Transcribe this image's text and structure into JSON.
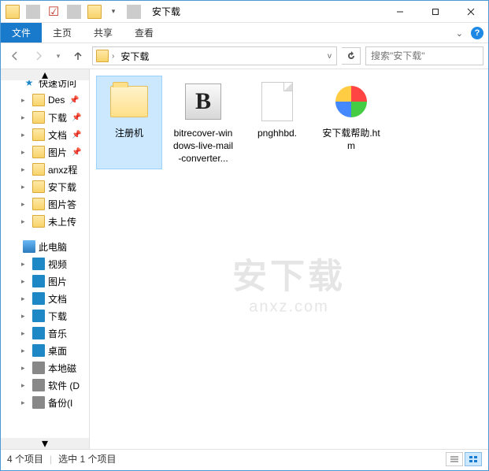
{
  "window": {
    "title": "安下载"
  },
  "ribbon": {
    "file": "文件",
    "tabs": [
      "主页",
      "共享",
      "查看"
    ]
  },
  "address": {
    "crumbs": [
      "安下载"
    ],
    "search_placeholder": "搜索\"安下载\""
  },
  "sidebar": {
    "quick_access": "快速访问",
    "quick_items": [
      {
        "label": "Des",
        "pinned": true
      },
      {
        "label": "下载",
        "pinned": true
      },
      {
        "label": "文档",
        "pinned": true
      },
      {
        "label": "图片",
        "pinned": true
      },
      {
        "label": "anxz程"
      },
      {
        "label": "安下载"
      },
      {
        "label": "图片答"
      },
      {
        "label": "未上传"
      }
    ],
    "this_pc": "此电脑",
    "pc_items": [
      {
        "label": "视频",
        "color": "#1e88c7"
      },
      {
        "label": "图片",
        "color": "#1e88c7"
      },
      {
        "label": "文档",
        "color": "#1e88c7"
      },
      {
        "label": "下载",
        "color": "#1e88c7"
      },
      {
        "label": "音乐",
        "color": "#1e88c7"
      },
      {
        "label": "桌面",
        "color": "#1e88c7"
      },
      {
        "label": "本地磁",
        "color": "#888"
      },
      {
        "label": "软件 (D",
        "color": "#888"
      },
      {
        "label": "备份(I",
        "color": "#888"
      }
    ]
  },
  "files": [
    {
      "name": "注册机",
      "type": "folder",
      "selected": true
    },
    {
      "name": "bitrecover-windows-live-mail-converter...",
      "type": "bicon"
    },
    {
      "name": "pnghhbd.",
      "type": "doc"
    },
    {
      "name": "安下载帮助.htm",
      "type": "wheel"
    }
  ],
  "status": {
    "count": "4 个项目",
    "selected": "选中 1 个项目"
  },
  "watermark": {
    "top": "安下载",
    "bottom": "anxz.com"
  }
}
